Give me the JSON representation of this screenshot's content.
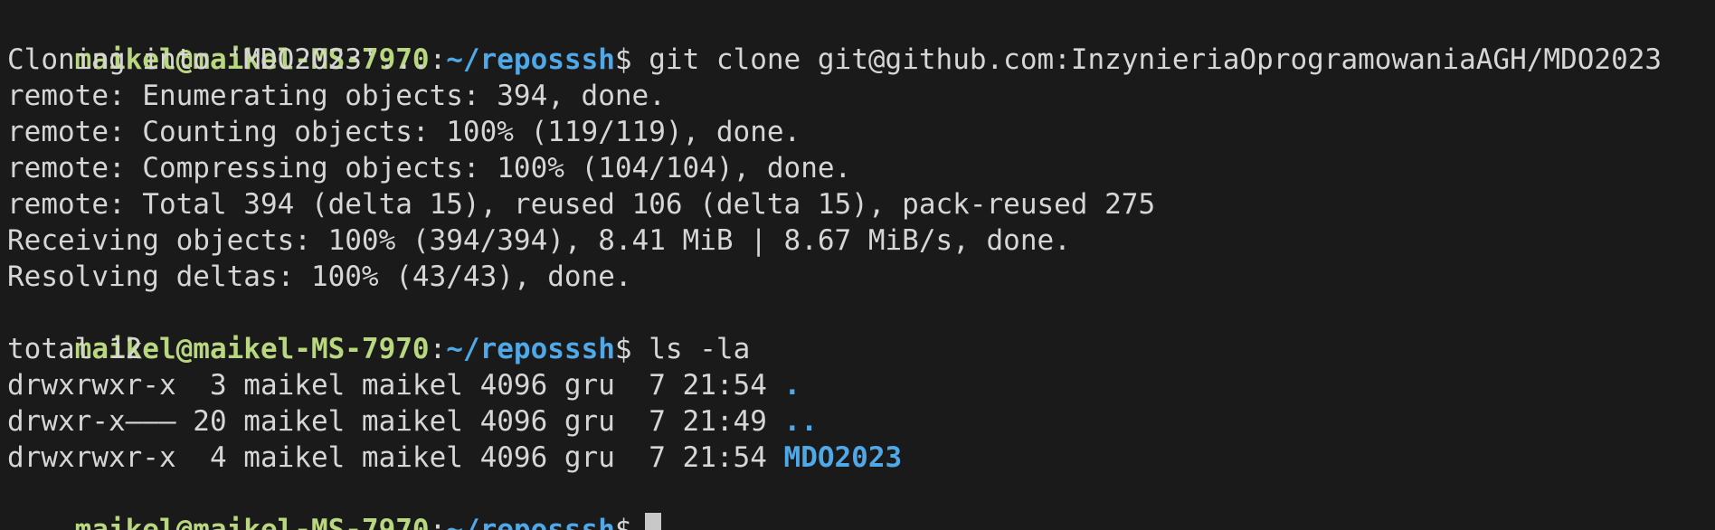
{
  "prompt": {
    "user_host": "maikel@maikel-MS-7970",
    "colon": ":",
    "path": "~/reposssh",
    "dollar": "$"
  },
  "commands": {
    "clone": "git clone git@github.com:InzynieriaOprogramowaniaAGH/MDO2023",
    "ls": "ls -la"
  },
  "clone_output": [
    "Cloning into 'MDO2023'...",
    "remote: Enumerating objects: 394, done.",
    "remote: Counting objects: 100% (119/119), done.",
    "remote: Compressing objects: 100% (104/104), done.",
    "remote: Total 394 (delta 15), reused 106 (delta 15), pack-reused 275",
    "Receiving objects: 100% (394/394), 8.41 MiB | 8.67 MiB/s, done.",
    "Resolving deltas: 100% (43/43), done."
  ],
  "ls_output": {
    "total": "total 12",
    "entries": [
      {
        "meta": "drwxrwxr-x  3 maikel maikel 4096 gru  7 21:54 ",
        "name": "."
      },
      {
        "meta": "drwxr-x——— 20 maikel maikel 4096 gru  7 21:49 ",
        "name": ".."
      },
      {
        "meta": "drwxrwxr-x  4 maikel maikel 4096 gru  7 21:54 ",
        "name": "MDO2023"
      }
    ]
  },
  "colors": {
    "background": "#1a1a1a",
    "prompt_user": "#b9d77f",
    "prompt_path": "#4fa8e8",
    "text": "#d6d6d6"
  }
}
